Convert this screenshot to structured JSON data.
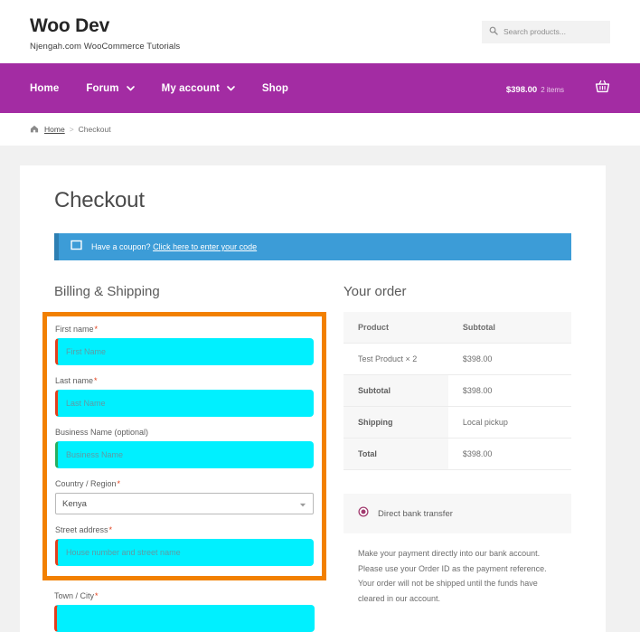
{
  "header": {
    "site_title": "Woo Dev",
    "tagline": "Njengah.com WooCommerce Tutorials",
    "search_placeholder": "Search products...",
    "search_icon": "search-icon"
  },
  "nav": {
    "items": [
      {
        "label": "Home",
        "has_dropdown": false
      },
      {
        "label": "Forum",
        "has_dropdown": true
      },
      {
        "label": "My account",
        "has_dropdown": true
      },
      {
        "label": "Shop",
        "has_dropdown": false
      }
    ],
    "cart_total": "$398.00",
    "cart_items": "2 items",
    "cart_icon": "shopping-basket-icon",
    "bar_color": "#a32ca3"
  },
  "breadcrumb": {
    "home_icon": "home-icon",
    "home_label": "Home",
    "separator": ">",
    "current": "Checkout"
  },
  "main": {
    "page_title": "Checkout",
    "coupon": {
      "icon": "coupon-tag-icon",
      "text": "Have a coupon?",
      "link_text": "Click here to enter your code",
      "bg_color": "#3c9cd7",
      "accent_color": "#2d7fb3"
    },
    "billing": {
      "section_title": "Billing & Shipping",
      "highlight_color": "#f28000",
      "required_marker": "*",
      "fields": [
        {
          "label": "First name",
          "required": true,
          "placeholder": "First Name",
          "value": "",
          "type": "text",
          "highlighted": true
        },
        {
          "label": "Last name",
          "required": true,
          "placeholder": "Last Name",
          "value": "",
          "type": "text",
          "highlighted": true
        },
        {
          "label": "Business Name (optional)",
          "required": false,
          "placeholder": "Business Name",
          "value": "",
          "type": "text",
          "highlighted": true
        },
        {
          "label": "Country / Region",
          "required": true,
          "placeholder": "",
          "value": "Kenya",
          "type": "select",
          "highlighted": true
        },
        {
          "label": "Street address",
          "required": true,
          "placeholder": "House number and street name",
          "value": "",
          "type": "text",
          "highlighted": true
        },
        {
          "label": "Town / City",
          "required": true,
          "placeholder": "",
          "value": "",
          "type": "text",
          "highlighted": false
        }
      ]
    },
    "order": {
      "section_title": "Your order",
      "columns": [
        "Product",
        "Subtotal"
      ],
      "line_items": [
        {
          "name": "Test Product",
          "qty": "× 2",
          "subtotal": "$398.00"
        }
      ],
      "totals": [
        {
          "label": "Subtotal",
          "value": "$398.00"
        },
        {
          "label": "Shipping",
          "value": "Local pickup"
        },
        {
          "label": "Total",
          "value": "$398.00"
        }
      ]
    },
    "payment": {
      "method_label": "Direct bank transfer",
      "radio_icon": "radio-selected-icon",
      "description": "Make your payment directly into our bank account. Please use your Order ID as the payment reference. Your order will not be shipped until the funds have cleared in our account."
    }
  }
}
